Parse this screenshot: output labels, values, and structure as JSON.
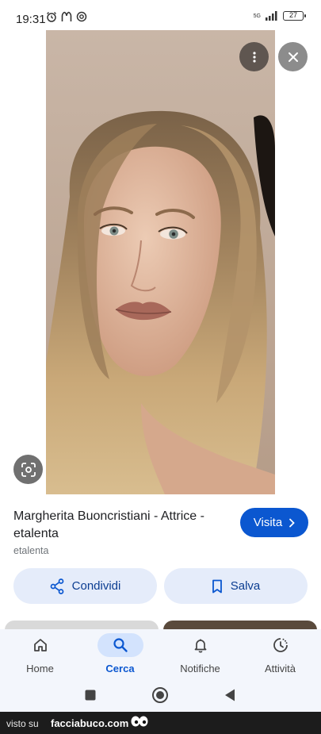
{
  "status_bar": {
    "time": "19:31",
    "network_label": "5G",
    "battery": "27"
  },
  "image_viewer": {
    "more_icon": "more-vert-icon",
    "close_icon": "close-icon",
    "lens_icon": "google-lens-icon"
  },
  "result": {
    "title": "Margherita Buoncristiani - Attrice - etalenta",
    "source": "etalenta",
    "visit_label": "Visita"
  },
  "actions": {
    "share_label": "Condividi",
    "save_label": "Salva"
  },
  "bottom_nav": {
    "items": [
      {
        "label": "Home",
        "icon": "home-icon",
        "active": false
      },
      {
        "label": "Cerca",
        "icon": "search-icon",
        "active": true
      },
      {
        "label": "Notifiche",
        "icon": "bell-icon",
        "active": false
      },
      {
        "label": "Attività",
        "icon": "history-icon",
        "active": false
      }
    ]
  },
  "watermark": {
    "prefix": "visto su",
    "brand": "facciabuco.com"
  },
  "colors": {
    "accent": "#0b57d0",
    "action_bg": "#e5ecfa",
    "nav_bg": "#f3f6fc",
    "nav_active_pill": "#d3e3fd"
  }
}
